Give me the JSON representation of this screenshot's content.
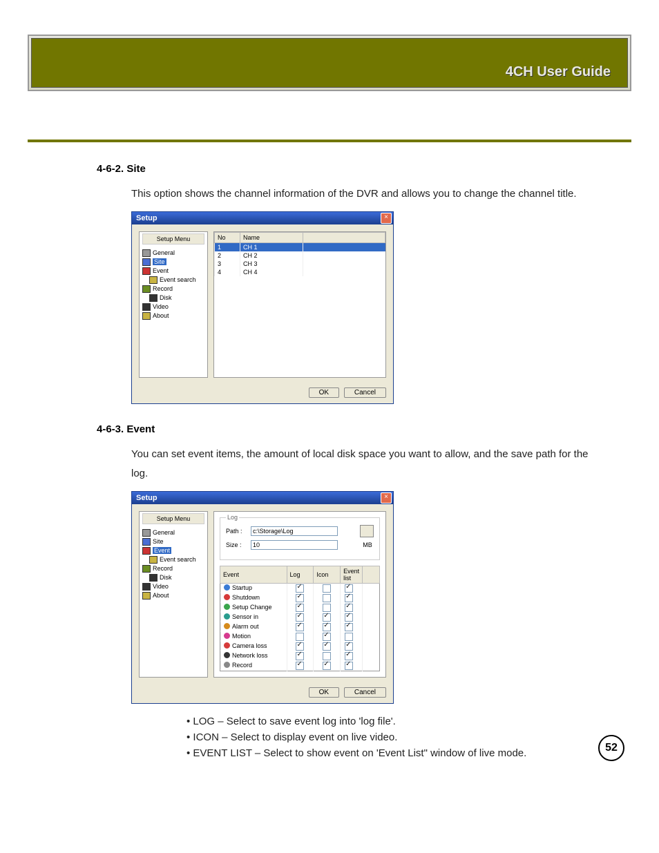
{
  "header": {
    "title": "4CH User Guide"
  },
  "section1": {
    "head": "4-6-2. Site",
    "text": "This option shows the channel information of the DVR and allows you to change the channel title."
  },
  "section2": {
    "head": "4-6-3. Event",
    "text": "You can set event items, the amount of local disk space you want to allow, and the save path for the log."
  },
  "bullets": {
    "b1": "• LOG – Select to save event log into 'log file'.",
    "b2": "• ICON – Select to display event on live video.",
    "b3": "• EVENT LIST – Select to show event on 'Event List\" window of live mode."
  },
  "setup": {
    "title": "Setup",
    "menu_title": "Setup Menu",
    "tree": {
      "general": "General",
      "site": "Site",
      "event": "Event",
      "event_search": "Event search",
      "record": "Record",
      "disk": "Disk",
      "video": "Video",
      "about": "About"
    },
    "buttons": {
      "ok": "OK",
      "cancel": "Cancel"
    }
  },
  "site_table": {
    "cols": {
      "no": "No",
      "name": "Name"
    },
    "rows": [
      {
        "no": "1",
        "name": "CH 1"
      },
      {
        "no": "2",
        "name": "CH 2"
      },
      {
        "no": "3",
        "name": "CH 3"
      },
      {
        "no": "4",
        "name": "CH 4"
      }
    ]
  },
  "event_dialog": {
    "log": {
      "legend": "Log",
      "path_label": "Path :",
      "path_value": "c:\\Storage\\Log",
      "size_label": "Size :",
      "size_value": "10",
      "size_unit": "MB"
    },
    "cols": {
      "event": "Event",
      "log": "Log",
      "icon": "Icon",
      "list": "Event list"
    },
    "rows": [
      {
        "name": "Startup",
        "log": true,
        "icon": false,
        "list": true,
        "ic": "blue"
      },
      {
        "name": "Shutdown",
        "log": true,
        "icon": false,
        "list": true,
        "ic": "red"
      },
      {
        "name": "Setup Change",
        "log": true,
        "icon": false,
        "list": true,
        "ic": "green"
      },
      {
        "name": "Sensor in",
        "log": true,
        "icon": true,
        "list": true,
        "ic": "teal"
      },
      {
        "name": "Alarm out",
        "log": true,
        "icon": true,
        "list": true,
        "ic": "orange"
      },
      {
        "name": "Motion",
        "log": false,
        "icon": true,
        "list": false,
        "ic": "pink"
      },
      {
        "name": "Camera loss",
        "log": true,
        "icon": true,
        "list": true,
        "ic": "red"
      },
      {
        "name": "Network loss",
        "log": true,
        "icon": false,
        "list": true,
        "ic": "dark"
      },
      {
        "name": "Record",
        "log": true,
        "icon": true,
        "list": true,
        "ic": "grey"
      }
    ]
  },
  "page_number": "52"
}
